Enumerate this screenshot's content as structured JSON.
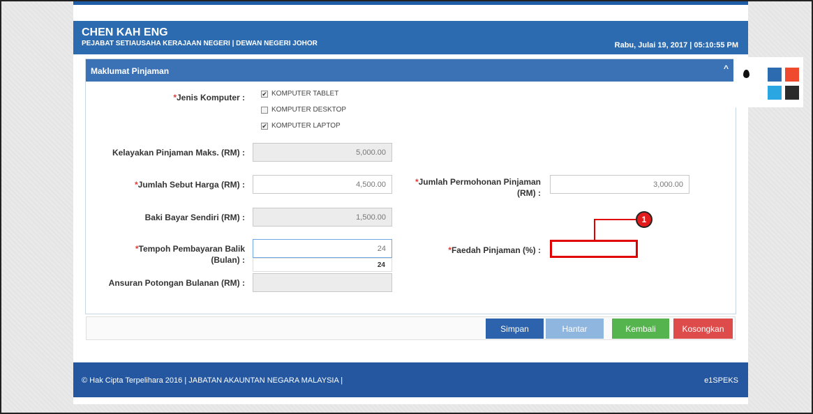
{
  "header": {
    "user_name": "CHEN KAH ENG",
    "organization": "PEJABAT SETIAUSAHA KERAJAAN NEGERI | DEWAN NEGERI JOHOR",
    "datetime": "Rabu, Julai 19, 2017 | 05:10:55 PM"
  },
  "panel": {
    "title": "Maklumat Pinjaman",
    "collapse_icon": "^"
  },
  "form": {
    "jenis_komputer": {
      "label": "Jenis Komputer :",
      "options": [
        {
          "label": "KOMPUTER TABLET",
          "checked": true
        },
        {
          "label": "KOMPUTER DESKTOP",
          "checked": false
        },
        {
          "label": "KOMPUTER LAPTOP",
          "checked": true
        }
      ]
    },
    "kelayakan": {
      "label": "Kelayakan Pinjaman Maks. (RM) :",
      "value": "5,000.00"
    },
    "sebut_harga": {
      "label": "Jumlah Sebut Harga (RM) :",
      "value": "4,500.00"
    },
    "permohonan": {
      "label_line1": "Jumlah Permohonan Pinjaman",
      "label_line2": "(RM) :",
      "value": "3,000.00"
    },
    "baki": {
      "label": "Baki Bayar Sendiri (RM) :",
      "value": "1,500.00"
    },
    "tempoh": {
      "label_line1": "Tempoh Pembayaran Balik",
      "label_line2": "(Bulan) :",
      "value": "24",
      "suggestion": "24"
    },
    "faedah": {
      "label": "Faedah Pinjaman (%) :",
      "value": ""
    },
    "ansuran": {
      "label": "Ansuran Potongan Bulanan (RM) :",
      "value": ""
    },
    "required_mark": "*"
  },
  "buttons": {
    "simpan": "Simpan",
    "hantar": "Hantar",
    "kembali": "Kembali",
    "kosongkan": "Kosongkan"
  },
  "footer": {
    "copyright": "© Hak Cipta Terpelihara 2016 | JABATAN AKAUNTAN NEGARA MALAYSIA |",
    "brand": "e1SPEKS"
  },
  "annotation": {
    "number": "1"
  },
  "colors": {
    "header": "#2d6bb0",
    "simpan": "#2d63ad",
    "hantar": "#8fb6df",
    "kembali": "#55b44d",
    "kosongkan": "#dd4b4b",
    "callout": "#e00000",
    "swatches": [
      "#2d6bb0",
      "#f04a2e",
      "#2aa7e2",
      "#2b2b2b"
    ]
  },
  "icons": {
    "theme": "drop-icon",
    "collapse": "chevron-up-icon"
  }
}
